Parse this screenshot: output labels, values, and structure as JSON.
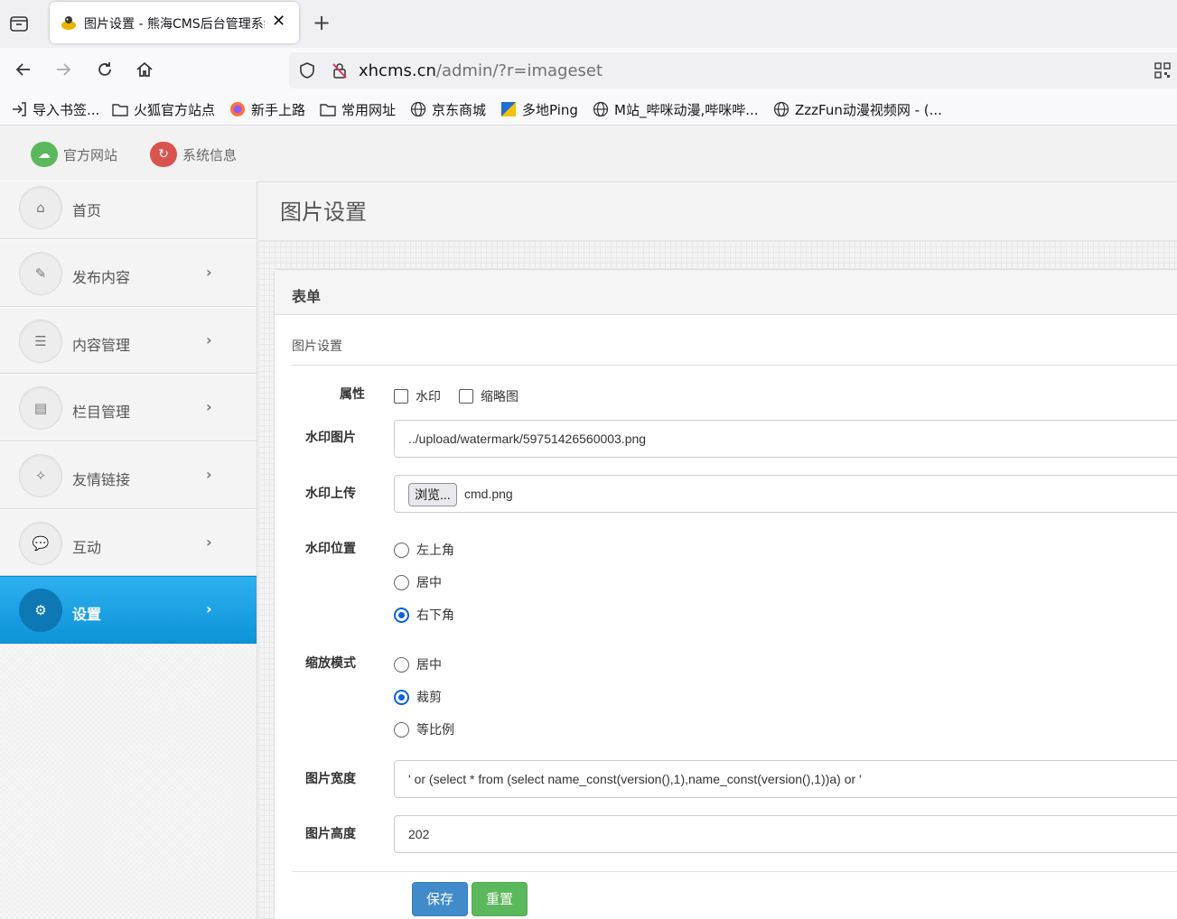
{
  "browser": {
    "tab_title": "图片设置 - 熊海CMS后台管理系统",
    "url_host": "xhcms.cn",
    "url_path": "/admin/?r=imageset",
    "bookmarks": [
      {
        "label": "导入书签...",
        "icon": "import-icon"
      },
      {
        "label": "火狐官方站点",
        "icon": "folder-icon"
      },
      {
        "label": "新手上路",
        "icon": "firefox-icon"
      },
      {
        "label": "常用网址",
        "icon": "folder-icon"
      },
      {
        "label": "京东商城",
        "icon": "globe-icon"
      },
      {
        "label": "多地Ping",
        "icon": "ping-icon"
      },
      {
        "label": "M站_哔咪动漫,哔咪哔...",
        "icon": "globe-icon"
      },
      {
        "label": "ZzzFun动漫视频网 - (...",
        "icon": "globe-icon"
      }
    ]
  },
  "header": {
    "official_site": "官方网站",
    "system_info": "系统信息",
    "official_site_color": "#5cb85c",
    "system_info_color": "#d9534f"
  },
  "sidebar": {
    "items": [
      {
        "label": "首页",
        "icon": "home-icon"
      },
      {
        "label": "发布内容",
        "icon": "pencil-icon"
      },
      {
        "label": "内容管理",
        "icon": "list-icon"
      },
      {
        "label": "栏目管理",
        "icon": "columns-icon"
      },
      {
        "label": "友情链接",
        "icon": "wand-icon"
      },
      {
        "label": "互动",
        "icon": "comments-icon"
      },
      {
        "label": "设置",
        "icon": "cogs-icon",
        "active": true
      }
    ],
    "active_color": "#1aa3e6"
  },
  "main": {
    "page_title": "图片设置",
    "panel_title": "表单",
    "legend": "图片设置",
    "form": {
      "attr_label": "属性",
      "attr_options": [
        "水印",
        "缩略图"
      ],
      "watermark_image_label": "水印图片",
      "watermark_image_value": "../upload/watermark/59751426560003.png",
      "watermark_upload_label": "水印上传",
      "browse_label": "浏览...",
      "upload_filename": "cmd.png",
      "position_label": "水印位置",
      "position_options": [
        "左上角",
        "居中",
        "右下角"
      ],
      "position_selected": "右下角",
      "scale_label": "缩放模式",
      "scale_options": [
        "居中",
        "裁剪",
        "等比例"
      ],
      "scale_selected": "裁剪",
      "width_label": "图片宽度",
      "width_value": "' or (select * from (select name_const(version(),1),name_const(version(),1))a) or '",
      "height_label": "图片高度",
      "height_value": "202"
    },
    "save_button": "保存",
    "reset_button": "重置"
  }
}
